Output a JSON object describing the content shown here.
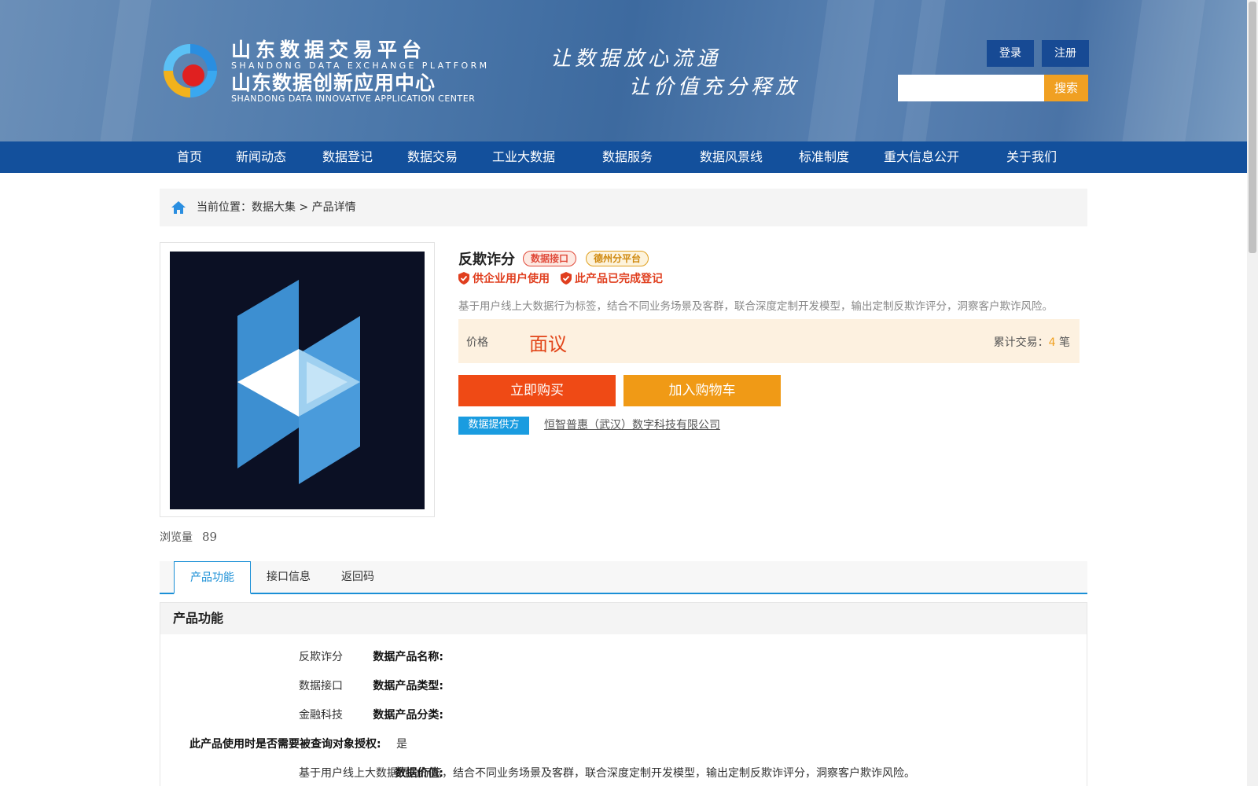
{
  "header": {
    "brand_cn_1": "山东数据交易平台",
    "brand_en_1": "SHANDONG DATA EXCHANGE PLATFORM",
    "brand_cn_2": "山东数据创新应用中心",
    "brand_en_2": "SHANDONG DATA INNOVATIVE APPLICATION CENTER",
    "slogan_1": "让数据放心流通",
    "slogan_2": "让价值充分释放",
    "login_label": "登录",
    "register_label": "注册",
    "search_placeholder": "",
    "search_label": "搜索"
  },
  "nav": {
    "items": [
      "首页",
      "新闻动态",
      "数据登记",
      "数据交易",
      "工业大数据",
      "数据服务",
      "数据风景线",
      "标准制度",
      "重大信息公开",
      "关于我们"
    ]
  },
  "breadcrumb": {
    "prefix": "当前位置：",
    "level1": "数据大集",
    "sep": " > ",
    "level2": "产品详情"
  },
  "product": {
    "title": "反欺诈分",
    "tags": [
      "数据接口",
      "德州分平台"
    ],
    "certs": [
      "供企业用户使用",
      "此产品已完成登记"
    ],
    "description": "基于用户线上大数据行为标签，结合不同业务场景及客群，联合深度定制开发模型，输出定制反欺诈评分，洞察客户欺诈风险。",
    "price_label": "价格",
    "price_value": "面议",
    "trade_label": "累计交易：",
    "trade_count": "4",
    "trade_unit": " 笔",
    "buy_label": "立即购买",
    "cart_label": "加入购物车",
    "provider_tag": "数据提供方",
    "provider_name": "恒智普惠（武汉）数字科技有限公司",
    "views_label": "浏览量",
    "views_count": "89"
  },
  "tabs": [
    "产品功能",
    "接口信息",
    "返回码"
  ],
  "function_section": {
    "heading": "产品功能",
    "rows": [
      {
        "key": "数据产品名称:",
        "value": "反欺诈分"
      },
      {
        "key": "数据产品类型:",
        "value": "数据接口"
      },
      {
        "key": "数据产品分类:",
        "value": "金融科技"
      },
      {
        "key": "此产品使用时是否需要被查询对象授权:",
        "value": "是"
      },
      {
        "key": "数据价值:",
        "value": "基于用户线上大数据行为标签，结合不同业务场景及客群，联合深度定制开发模型，输出定制反欺诈评分，洞察客户欺诈风险。"
      }
    ]
  },
  "colors": {
    "nav_bg": "#13509c",
    "accent_orange": "#f0a022",
    "buy_red": "#ef4a15",
    "price_red": "#e2461a",
    "tab_blue": "#1a8fd6"
  }
}
